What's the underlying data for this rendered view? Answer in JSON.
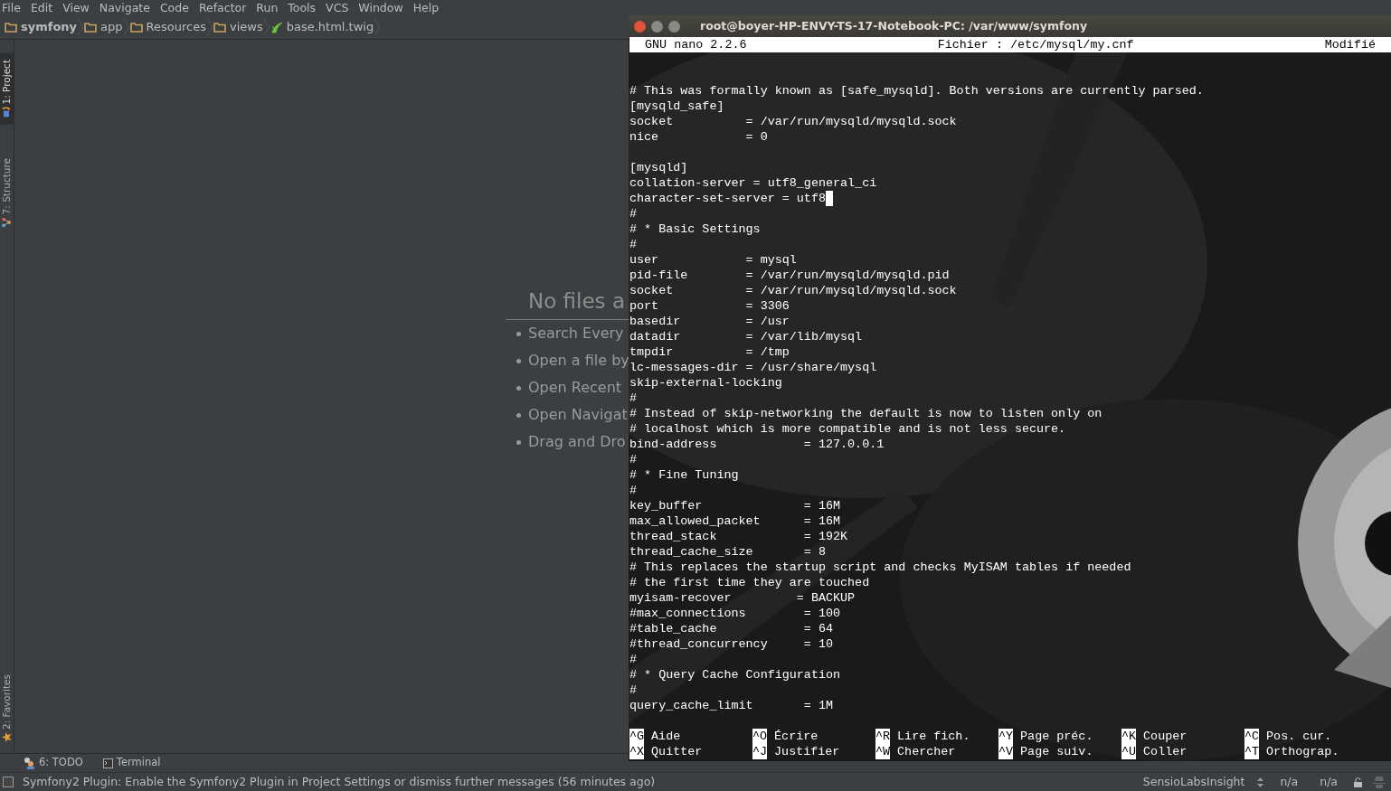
{
  "menu": [
    "File",
    "Edit",
    "View",
    "Navigate",
    "Code",
    "Refactor",
    "Run",
    "Tools",
    "VCS",
    "Window",
    "Help"
  ],
  "breadcrumb": [
    {
      "label": "symfony",
      "kind": "folder",
      "bold": true
    },
    {
      "label": "app",
      "kind": "folder",
      "bold": false
    },
    {
      "label": "Resources",
      "kind": "folder",
      "bold": false
    },
    {
      "label": "views",
      "kind": "folder",
      "bold": false
    },
    {
      "label": "base.html.twig",
      "kind": "twig",
      "bold": false
    }
  ],
  "tool_tabs": [
    {
      "label": "1: Project",
      "kind": "project",
      "selected": true
    },
    {
      "label": "7: Structure",
      "kind": "structure",
      "selected": false
    },
    {
      "label": "2: Favorites",
      "kind": "favorites",
      "selected": false
    }
  ],
  "welcome": {
    "title": "No files a",
    "items": [
      "Search Every",
      "Open a file by",
      "Open Recent",
      "Open Navigat",
      "Drag and Dro"
    ]
  },
  "terminal": {
    "title": "root@boyer-HP-ENVY-TS-17-Notebook-PC: /var/www/symfony",
    "nano": {
      "version": "GNU nano 2.2.6",
      "file": "Fichier : /etc/mysql/my.cnf",
      "status": "Modifié"
    },
    "lines": [
      {
        "kind": "blank",
        "cursor": false
      },
      {
        "kind": "blank",
        "cursor": false
      },
      {
        "kind": "text",
        "text": "# This was formally known as [safe_mysqld]. Both versions are currently parsed.",
        "cursor": false
      },
      {
        "kind": "text",
        "text": "[mysqld_safe]",
        "cursor": false
      },
      {
        "kind": "text",
        "text": "socket          = /var/run/mysqld/mysqld.sock",
        "cursor": false
      },
      {
        "kind": "text",
        "text": "nice            = 0",
        "cursor": false
      },
      {
        "kind": "blank",
        "cursor": false
      },
      {
        "kind": "text",
        "text": "[mysqld]",
        "cursor": false
      },
      {
        "kind": "text",
        "text": "collation-server = utf8_general_ci",
        "cursor": false
      },
      {
        "kind": "text",
        "text": "character-set-server = utf8",
        "cursor": true
      },
      {
        "kind": "text",
        "text": "#",
        "cursor": false
      },
      {
        "kind": "text",
        "text": "# * Basic Settings",
        "cursor": false
      },
      {
        "kind": "text",
        "text": "#",
        "cursor": false
      },
      {
        "kind": "text",
        "text": "user            = mysql",
        "cursor": false
      },
      {
        "kind": "text",
        "text": "pid-file        = /var/run/mysqld/mysqld.pid",
        "cursor": false
      },
      {
        "kind": "text",
        "text": "socket          = /var/run/mysqld/mysqld.sock",
        "cursor": false
      },
      {
        "kind": "text",
        "text": "port            = 3306",
        "cursor": false
      },
      {
        "kind": "text",
        "text": "basedir         = /usr",
        "cursor": false
      },
      {
        "kind": "text",
        "text": "datadir         = /var/lib/mysql",
        "cursor": false
      },
      {
        "kind": "text",
        "text": "tmpdir          = /tmp",
        "cursor": false
      },
      {
        "kind": "text",
        "text": "lc-messages-dir = /usr/share/mysql",
        "cursor": false
      },
      {
        "kind": "text",
        "text": "skip-external-locking",
        "cursor": false
      },
      {
        "kind": "text",
        "text": "#",
        "cursor": false
      },
      {
        "kind": "text",
        "text": "# Instead of skip-networking the default is now to listen only on",
        "cursor": false
      },
      {
        "kind": "text",
        "text": "# localhost which is more compatible and is not less secure.",
        "cursor": false
      },
      {
        "kind": "text",
        "text": "bind-address            = 127.0.0.1",
        "cursor": false
      },
      {
        "kind": "text",
        "text": "#",
        "cursor": false
      },
      {
        "kind": "text",
        "text": "# * Fine Tuning",
        "cursor": false
      },
      {
        "kind": "text",
        "text": "#",
        "cursor": false
      },
      {
        "kind": "text",
        "text": "key_buffer              = 16M",
        "cursor": false
      },
      {
        "kind": "text",
        "text": "max_allowed_packet      = 16M",
        "cursor": false
      },
      {
        "kind": "text",
        "text": "thread_stack            = 192K",
        "cursor": false
      },
      {
        "kind": "text",
        "text": "thread_cache_size       = 8",
        "cursor": false
      },
      {
        "kind": "text",
        "text": "# This replaces the startup script and checks MyISAM tables if needed",
        "cursor": false
      },
      {
        "kind": "text",
        "text": "# the first time they are touched",
        "cursor": false
      },
      {
        "kind": "text",
        "text": "myisam-recover         = BACKUP",
        "cursor": false
      },
      {
        "kind": "text",
        "text": "#max_connections        = 100",
        "cursor": false
      },
      {
        "kind": "text",
        "text": "#table_cache            = 64",
        "cursor": false
      },
      {
        "kind": "text",
        "text": "#thread_concurrency     = 10",
        "cursor": false
      },
      {
        "kind": "text",
        "text": "#",
        "cursor": false
      },
      {
        "kind": "text",
        "text": "# * Query Cache Configuration",
        "cursor": false
      },
      {
        "kind": "text",
        "text": "#",
        "cursor": false
      },
      {
        "kind": "text",
        "text": "query_cache_limit       = 1M",
        "cursor": false
      }
    ],
    "shortcuts": [
      {
        "key": "^G",
        "label": "Aide"
      },
      {
        "key": "^O",
        "label": "Écrire"
      },
      {
        "key": "^R",
        "label": "Lire fich."
      },
      {
        "key": "^Y",
        "label": "Page préc."
      },
      {
        "key": "^K",
        "label": "Couper"
      },
      {
        "key": "^C",
        "label": "Pos. cur."
      },
      {
        "key": "^X",
        "label": "Quitter"
      },
      {
        "key": "^J",
        "label": "Justifier"
      },
      {
        "key": "^W",
        "label": "Chercher"
      },
      {
        "key": "^V",
        "label": "Page suiv."
      },
      {
        "key": "^U",
        "label": "Coller"
      },
      {
        "key": "^T",
        "label": "Orthograp."
      }
    ]
  },
  "bottom_tools": [
    {
      "label": "6: TODO",
      "kind": "todo"
    },
    {
      "label": "Terminal",
      "kind": "terminal"
    }
  ],
  "status_bar": {
    "message": "Symfony2 Plugin: Enable the Symfony2 Plugin in Project Settings or dismiss further messages (56 minutes ago)",
    "plugin": "SensioLabsInsight",
    "fields": [
      "n/a",
      "n/a"
    ]
  }
}
